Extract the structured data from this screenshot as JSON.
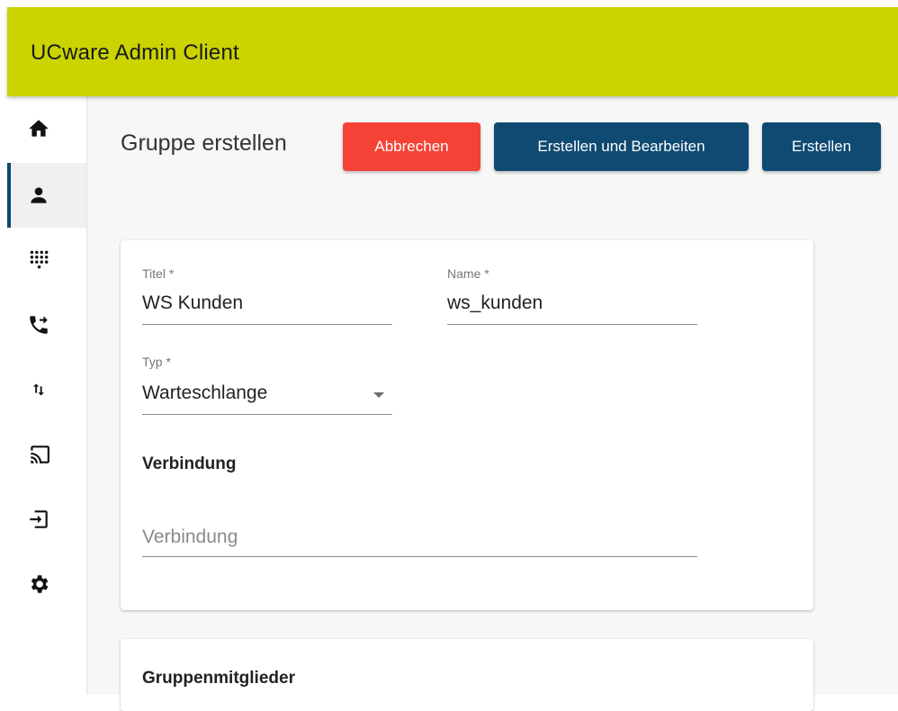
{
  "app": {
    "title": "UCware Admin Client"
  },
  "sidebar": {
    "items": [
      {
        "icon": "home-icon",
        "active": false
      },
      {
        "icon": "person-icon",
        "active": true
      },
      {
        "icon": "dialpad-icon",
        "active": false
      },
      {
        "icon": "phone-forward-icon",
        "active": false
      },
      {
        "icon": "swap-vert-icon",
        "active": false
      },
      {
        "icon": "cast-icon",
        "active": false
      },
      {
        "icon": "login-icon",
        "active": false
      },
      {
        "icon": "gear-icon",
        "active": false
      }
    ]
  },
  "page": {
    "title": "Gruppe erstellen",
    "buttons": {
      "cancel": "Abbrechen",
      "create_edit": "Erstellen und Bearbeiten",
      "create": "Erstellen"
    }
  },
  "form": {
    "titel": {
      "label": "Titel *",
      "value": "WS Kunden"
    },
    "name": {
      "label": "Name *",
      "value": "ws_kunden"
    },
    "typ": {
      "label": "Typ *",
      "value": "Warteschlange"
    },
    "verbindung_section": "Verbindung",
    "verbindung": {
      "placeholder": "Verbindung",
      "value": ""
    }
  },
  "members_card": {
    "title": "Gruppenmitglieder"
  },
  "colors": {
    "header": "#cbd300",
    "cancel": "#f44336",
    "primary": "#0e4a72",
    "active_indicator": "#0c4a6e"
  }
}
